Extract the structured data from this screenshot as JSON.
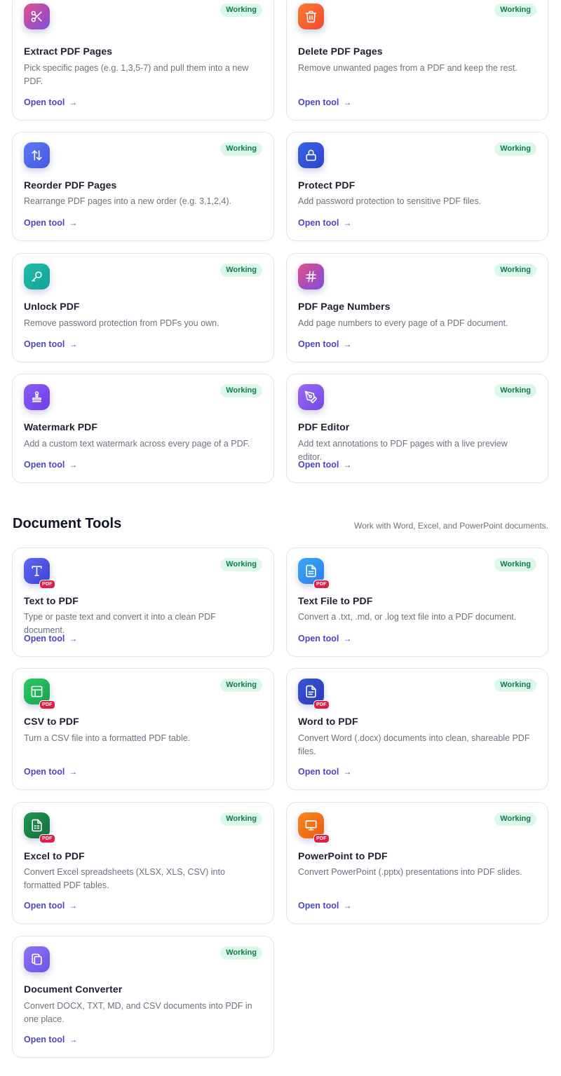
{
  "status_label": "Working",
  "open_label": "Open tool",
  "arrow": "→",
  "pdf_tag": "PDF",
  "pdf_tools": [
    {
      "title": "Extract PDF Pages",
      "desc": "Pick specific pages (e.g. 1,3,5-7) and pull them into a new PDF.",
      "icon": "scissors-icon"
    },
    {
      "title": "Delete PDF Pages",
      "desc": "Remove unwanted pages from a PDF and keep the rest.",
      "icon": "trash-icon"
    },
    {
      "title": "Reorder PDF Pages",
      "desc": "Rearrange PDF pages into a new order (e.g. 3,1,2,4).",
      "icon": "reorder-arrows-icon"
    },
    {
      "title": "Protect PDF",
      "desc": "Add password protection to sensitive PDF files.",
      "icon": "lock-icon"
    },
    {
      "title": "Unlock PDF",
      "desc": "Remove password protection from PDFs you own.",
      "icon": "key-icon"
    },
    {
      "title": "PDF Page Numbers",
      "desc": "Add page numbers to every page of a PDF document.",
      "icon": "hash-icon"
    },
    {
      "title": "Watermark PDF",
      "desc": "Add a custom text watermark across every page of a PDF.",
      "icon": "stamp-icon"
    },
    {
      "title": "PDF Editor",
      "desc": "Add text annotations to PDF pages with a live preview editor.",
      "icon": "pen-tool-icon"
    }
  ],
  "document_section": {
    "title": "Document Tools",
    "subtitle": "Work with Word, Excel, and PowerPoint documents."
  },
  "doc_tools": [
    {
      "title": "Text to PDF",
      "desc": "Type or paste text and convert it into a clean PDF document.",
      "icon": "text-type-icon"
    },
    {
      "title": "Text File to PDF",
      "desc": "Convert a .txt, .md, or .log text file into a PDF document.",
      "icon": "file-text-icon"
    },
    {
      "title": "CSV to PDF",
      "desc": "Turn a CSV file into a formatted PDF table.",
      "icon": "table-icon"
    },
    {
      "title": "Word to PDF",
      "desc": "Convert Word (.docx) documents into clean, shareable PDF files.",
      "icon": "word-file-icon"
    },
    {
      "title": "Excel to PDF",
      "desc": "Convert Excel spreadsheets (XLSX, XLS, CSV) into formatted PDF tables.",
      "icon": "spreadsheet-icon"
    },
    {
      "title": "PowerPoint to PDF",
      "desc": "Convert PowerPoint (.pptx) presentations into PDF slides.",
      "icon": "presentation-icon"
    },
    {
      "title": "Document Converter",
      "desc": "Convert DOCX, TXT, MD, and CSV documents into PDF in one place.",
      "icon": "copy-files-icon"
    }
  ],
  "colors": {
    "badge_bg": "#ddf7ea",
    "badge_text": "#127a4c",
    "link": "#4f46c6",
    "pdf_tag": "#e11d48"
  }
}
